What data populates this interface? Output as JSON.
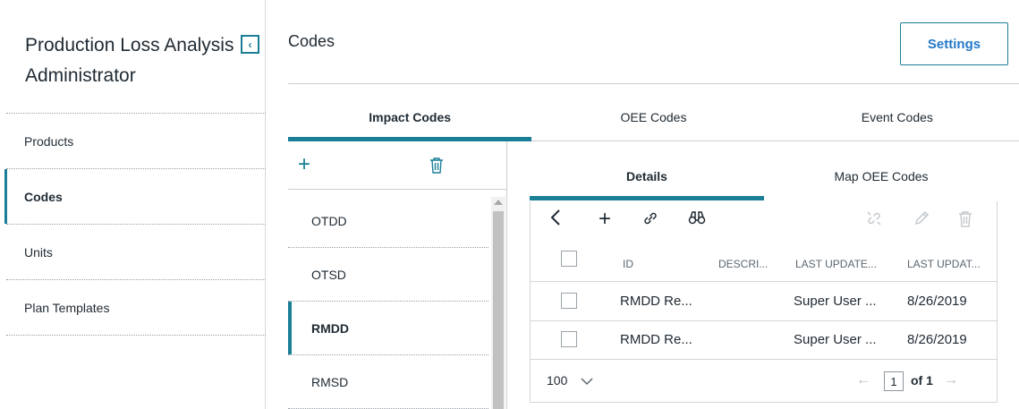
{
  "app": {
    "title": "Production Loss Analysis Administrator",
    "collapse_glyph": "‹"
  },
  "sidebar": {
    "items": [
      {
        "label": "Products"
      },
      {
        "label": "Codes"
      },
      {
        "label": "Units"
      },
      {
        "label": "Plan Templates"
      }
    ],
    "active": "Codes"
  },
  "header": {
    "title": "Codes",
    "settings_label": "Settings"
  },
  "tabs": {
    "items": [
      {
        "label": "Impact Codes"
      },
      {
        "label": "OEE Codes"
      },
      {
        "label": "Event Codes"
      }
    ],
    "active": "Impact Codes"
  },
  "code_list": {
    "items": [
      {
        "label": "OTDD"
      },
      {
        "label": "OTSD"
      },
      {
        "label": "RMDD"
      },
      {
        "label": "RMSD"
      }
    ],
    "active": "RMDD"
  },
  "detail_tabs": {
    "items": [
      {
        "label": "Details"
      },
      {
        "label": "Map OEE Codes"
      }
    ],
    "active": "Details"
  },
  "grid": {
    "columns": [
      "ID",
      "DESCRI...",
      "LAST UPDATE...",
      "LAST UPDAT..."
    ],
    "rows": [
      {
        "id": "RMDD Re...",
        "description": "",
        "updated_by": "Super User ...",
        "updated_on": "8/26/2019"
      },
      {
        "id": "RMDD Re...",
        "description": "",
        "updated_by": "Super User ...",
        "updated_on": "8/26/2019"
      }
    ],
    "page_size": "100",
    "current_page": "1",
    "page_total": "of 1"
  },
  "icons": {
    "back": "back-icon",
    "add": "plus-icon",
    "link": "link-icon",
    "find": "binoculars-icon",
    "unlink": "unlink-icon",
    "edit": "pencil-icon",
    "delete": "trash-icon"
  },
  "colors": {
    "accent": "#1a7e96",
    "link_blue": "#2379c9",
    "disabled": "#c3c8cc"
  }
}
